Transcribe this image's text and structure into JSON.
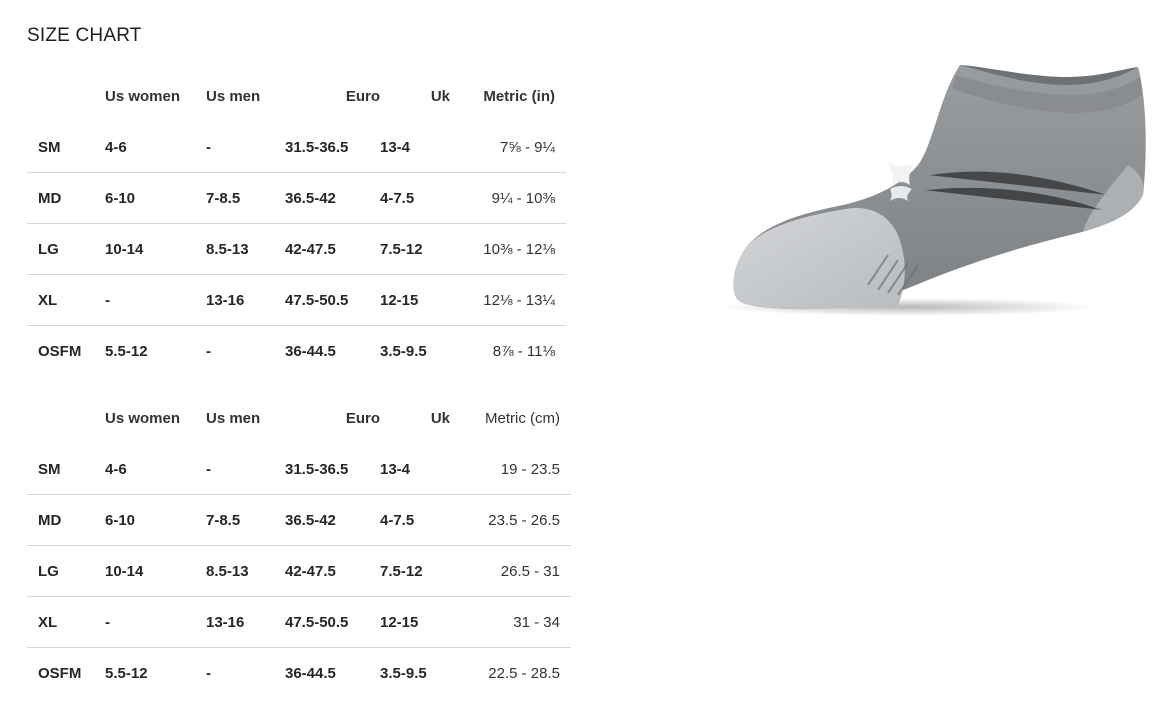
{
  "page": {
    "title": "SIZE CHART"
  },
  "table_in": {
    "headers": [
      "",
      "Us women",
      "Us men",
      "Euro",
      "Uk",
      "Metric (in)"
    ],
    "rows": [
      {
        "size": "SM",
        "us_women": "4-6",
        "us_men": "-",
        "euro": "31.5-36.5",
        "uk": "13-4",
        "metric": "7⅝ - 9¼"
      },
      {
        "size": "MD",
        "us_women": "6-10",
        "us_men": "7-8.5",
        "euro": "36.5-42",
        "uk": "4-7.5",
        "metric": "9¼ - 10⅜"
      },
      {
        "size": "LG",
        "us_women": "10-14",
        "us_men": "8.5-13",
        "euro": "42-47.5",
        "uk": "7.5-12",
        "metric": "10⅜ - 12⅛"
      },
      {
        "size": "XL",
        "us_women": "-",
        "us_men": "13-16",
        "euro": "47.5-50.5",
        "uk": "12-15",
        "metric": "12⅛ - 13¼"
      },
      {
        "size": "OSFM",
        "us_women": "5.5-12",
        "us_men": "-",
        "euro": "36-44.5",
        "uk": "3.5-9.5",
        "metric": "8⅞ - 11⅛"
      }
    ]
  },
  "table_cm": {
    "headers": [
      "",
      "Us women",
      "Us men",
      "Euro",
      "Uk",
      "Metric (cm)"
    ],
    "rows": [
      {
        "size": "SM",
        "us_women": "4-6",
        "us_men": "-",
        "euro": "31.5-36.5",
        "uk": "13-4",
        "metric": "19 - 23.5"
      },
      {
        "size": "MD",
        "us_women": "6-10",
        "us_men": "7-8.5",
        "euro": "36.5-42",
        "uk": "4-7.5",
        "metric": "23.5 - 26.5"
      },
      {
        "size": "LG",
        "us_women": "10-14",
        "us_men": "8.5-13",
        "euro": "42-47.5",
        "uk": "7.5-12",
        "metric": "26.5 - 31"
      },
      {
        "size": "XL",
        "us_women": "-",
        "us_men": "13-16",
        "euro": "47.5-50.5",
        "uk": "12-15",
        "metric": "31 - 34"
      },
      {
        "size": "OSFM",
        "us_women": "5.5-12",
        "us_men": "-",
        "euro": "36-44.5",
        "uk": "3.5-9.5",
        "metric": "22.5 - 28.5"
      }
    ]
  },
  "product_image": {
    "icon": "sock-icon",
    "colors": {
      "body": "#8d9093",
      "toe_heel": "#c9cbcd",
      "logo": "#f2f3f4"
    }
  }
}
